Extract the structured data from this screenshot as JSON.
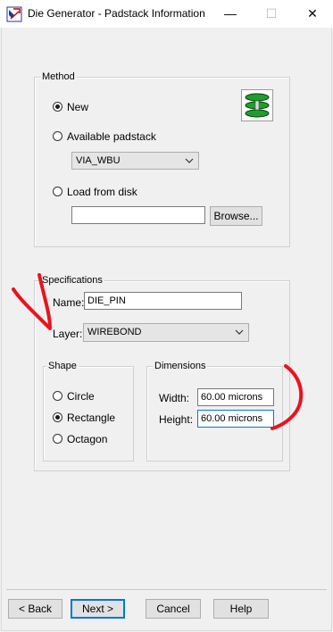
{
  "window": {
    "title": "Die Generator - Padstack Information",
    "minimize_glyph": "—",
    "maximize_glyph": "☐",
    "close_glyph": "✕"
  },
  "method": {
    "legend": "Method",
    "new_label": "New",
    "available_label": "Available padstack",
    "padstack_value": "VIA_WBU",
    "load_label": "Load from disk",
    "file_value": "",
    "browse_label": "Browse...",
    "selected": "new",
    "padstack_icon": "padstack-stack-icon"
  },
  "specifications": {
    "legend": "Specifications",
    "name_label": "Name:",
    "name_value": "DIE_PIN",
    "layer_label": "Layer:",
    "layer_value": "WIREBOND",
    "shape": {
      "legend": "Shape",
      "circle_label": "Circle",
      "rectangle_label": "Rectangle",
      "octagon_label": "Octagon",
      "selected": "rectangle"
    },
    "dimensions": {
      "legend": "Dimensions",
      "width_label": "Width:",
      "width_value": "60.00 microns",
      "height_label": "Height:",
      "height_value": "60.00 microns"
    }
  },
  "footer": {
    "back_label": "< Back",
    "next_label": "Next >",
    "cancel_label": "Cancel",
    "help_label": "Help"
  },
  "annotation_color": "#e8141e"
}
